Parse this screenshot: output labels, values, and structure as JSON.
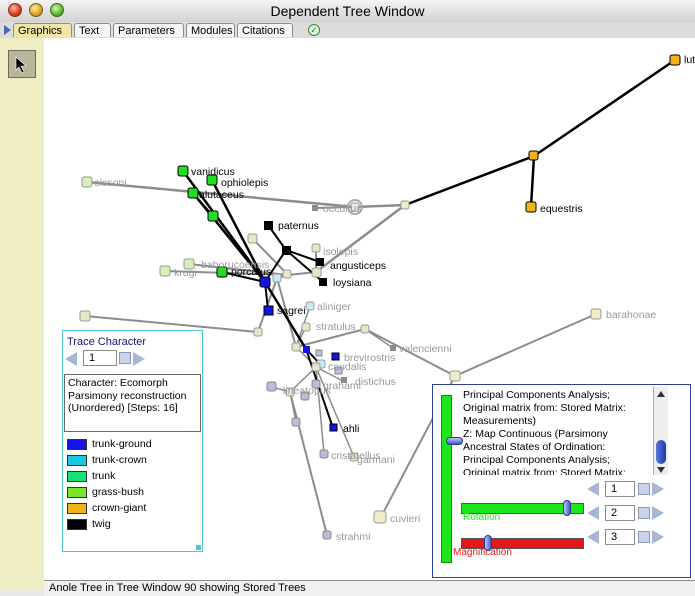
{
  "window": {
    "title": "Dependent Tree Window"
  },
  "tabs": [
    {
      "label": "Graphics",
      "active": true
    },
    {
      "label": "Text"
    },
    {
      "label": "Parameters"
    },
    {
      "label": "Modules"
    },
    {
      "label": "Citations"
    }
  ],
  "tree": {
    "labels": {
      "lutea": "lut",
      "equestris": "equestris",
      "vanidicus": "vanidicus",
      "ophiolepis": "ophiolepis",
      "alutaceus": "alutaceus",
      "olssoni": "olssoni",
      "occultus": "occultus",
      "paternus": "paternus",
      "isolepis": "isolepis",
      "angusticeps": "angusticeps",
      "bahorucoensis": "bahorucoensis",
      "krugi": "krugi",
      "porcatus": "porcatus",
      "loysiana": "loysiana",
      "aliniger": "aliniger",
      "sagrei": "sagrei",
      "stratulus": "stratulus",
      "valencienni": "valencienni",
      "brevirostris": "brevirostris",
      "caudalis": "caudalis",
      "distichus": "distichus",
      "grahami": "grahami",
      "lineatopus": "lineatopus",
      "ahli": "ahli",
      "barahonae": "barahonae",
      "cristatellus": "cristatellus",
      "garmani": "garmani",
      "cuvieri": "cuvieri",
      "strahmi": "strahmi"
    }
  },
  "trace_character": {
    "title": "Trace Character",
    "character_number": "1",
    "description": "Character: Ecomorph\nParsimony reconstruction\n(Unordered) [Steps: 16]",
    "legend": [
      {
        "label": "trunk-ground",
        "color": "#1414e6"
      },
      {
        "label": "trunk-crown",
        "color": "#17c9e2"
      },
      {
        "label": "trunk",
        "color": "#17e27a"
      },
      {
        "label": "grass-bush",
        "color": "#7ae62a"
      },
      {
        "label": "crown-giant",
        "color": "#f2b21a"
      },
      {
        "label": "twig",
        "color": "#000000"
      }
    ]
  },
  "ordination": {
    "text": "Principal Components Analysis;\nOriginal matrix from: Stored Matrix:\nMeasurements)\nZ:  Map Continuous (Parsimony\nAncestral States of Ordination:\nPrincipal Components Analysis;\nOriginal matrix from: Stored Matrix:\nMeasurements)",
    "axis_values": [
      "1",
      "2",
      "3"
    ],
    "rotation_label": "Rotation",
    "magnification_label": "Magnification",
    "colors": {
      "rotation": "#1ce61c",
      "magnification": "#e41818"
    }
  },
  "status_bar": {
    "text": "Anole Tree in Tree Window 90 showing Stored Trees"
  }
}
